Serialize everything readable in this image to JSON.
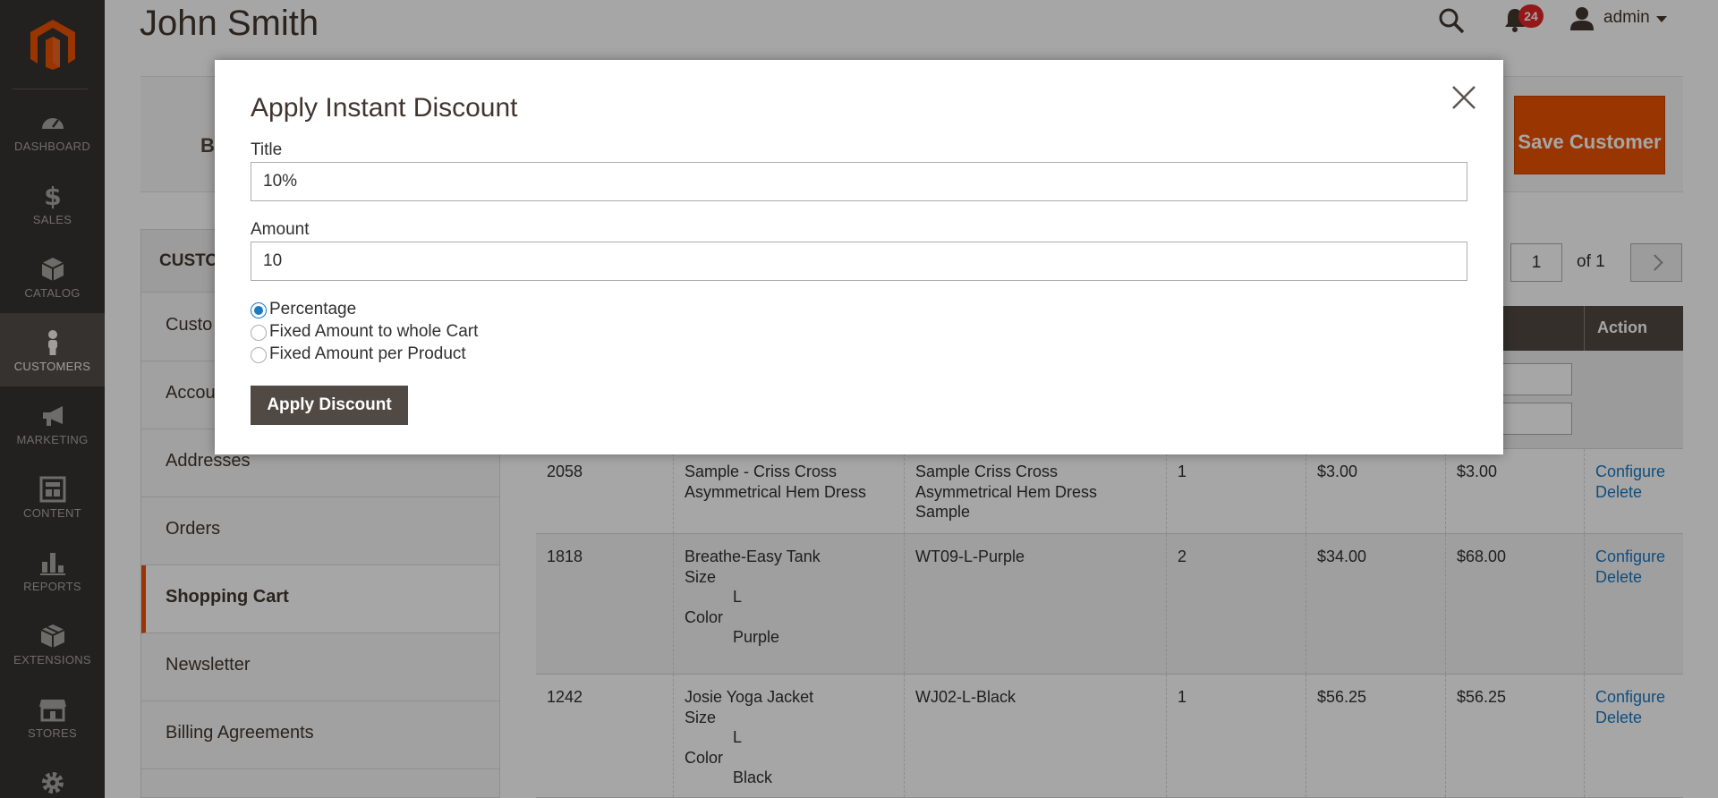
{
  "sidebar": {
    "items": [
      {
        "label": "DASHBOARD",
        "icon": "dashboard-icon"
      },
      {
        "label": "SALES",
        "icon": "dollar-icon"
      },
      {
        "label": "CATALOG",
        "icon": "cube-icon"
      },
      {
        "label": "CUSTOMERS",
        "icon": "person-icon",
        "active": true
      },
      {
        "label": "MARKETING",
        "icon": "megaphone-icon"
      },
      {
        "label": "CONTENT",
        "icon": "layout-icon"
      },
      {
        "label": "REPORTS",
        "icon": "bar-chart-icon"
      },
      {
        "label": "EXTENSIONS",
        "icon": "puzzle-box-icon"
      },
      {
        "label": "STORES",
        "icon": "store-icon"
      },
      {
        "label": "",
        "icon": "gear-icon"
      }
    ]
  },
  "header": {
    "title": "John Smith",
    "notifications_count": "24",
    "user": "admin"
  },
  "actions": {
    "back_fragment": "B",
    "save_label": "Save Customer"
  },
  "tabs": {
    "heading_fragment": "CUSTO",
    "items": [
      {
        "label": "Custo"
      },
      {
        "label": "Accou"
      },
      {
        "label": "Addresses"
      },
      {
        "label": "Orders"
      },
      {
        "label": "Shopping Cart",
        "active": true
      },
      {
        "label": "Newsletter"
      },
      {
        "label": "Billing Agreements"
      }
    ]
  },
  "pager": {
    "page": "1",
    "of_label": "of 1"
  },
  "grid": {
    "action_header": "Action",
    "rows": [
      {
        "id": "2058",
        "product": [
          "Sample - Criss Cross Asymmetrical Hem Dress"
        ],
        "options": [],
        "sku": "Sample Criss Cross Asymmetrical Hem Dress Sample",
        "qty": "1",
        "price": "$3.00",
        "total": "$3.00",
        "configure": "Configure",
        "delete": "Delete"
      },
      {
        "id": "1818",
        "product": [
          "Breathe-Easy Tank"
        ],
        "options": [
          [
            "Size",
            "L"
          ],
          [
            "Color",
            "Purple"
          ]
        ],
        "sku": "WT09-L-Purple",
        "qty": "2",
        "price": "$34.00",
        "total": "$68.00",
        "configure": "Configure",
        "delete": "Delete"
      },
      {
        "id": "1242",
        "product": [
          "Josie Yoga Jacket"
        ],
        "options": [
          [
            "Size",
            "L"
          ],
          [
            "Color",
            "Black"
          ]
        ],
        "sku": "WJ02-L-Black",
        "qty": "1",
        "price": "$56.25",
        "total": "$56.25",
        "configure": "Configure",
        "delete": "Delete"
      }
    ]
  },
  "modal": {
    "title": "Apply Instant Discount",
    "title_label": "Title",
    "title_value": "10%",
    "amount_label": "Amount",
    "amount_value": "10",
    "options": [
      {
        "label": "Percentage",
        "checked": true
      },
      {
        "label": "Fixed Amount to whole Cart",
        "checked": false
      },
      {
        "label": "Fixed Amount per Product",
        "checked": false
      }
    ],
    "apply_label": "Apply Discount"
  },
  "colors": {
    "accent": "#eb5202",
    "sidebar_bg": "#373330",
    "link": "#1979c3",
    "button_dark": "#514943"
  }
}
